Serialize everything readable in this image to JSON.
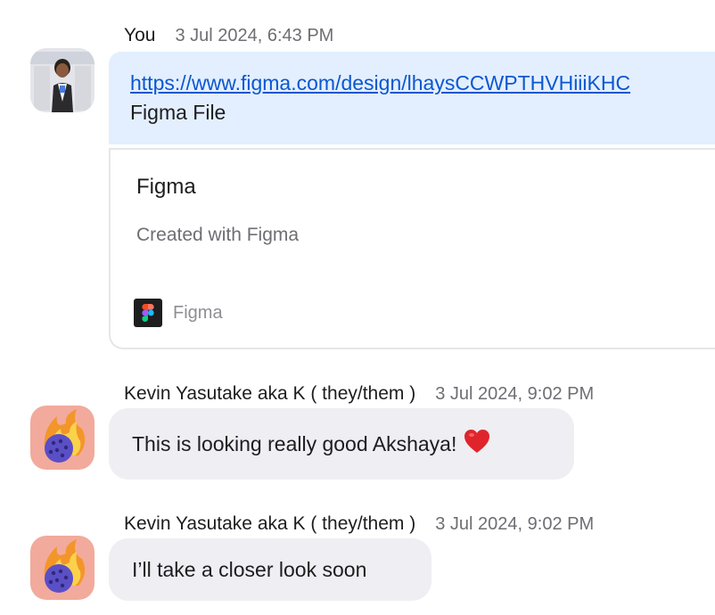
{
  "messages": [
    {
      "sender": "You",
      "time": "3 Jul 2024, 6:43 PM",
      "link": "https://www.figma.com/design/lhaysCCWPTHVHiiiKHC",
      "link_text": "Figma File",
      "preview": {
        "title": "Figma",
        "description": "Created with Figma",
        "source": "Figma"
      }
    },
    {
      "sender": "Kevin Yasutake aka K ( they/them )",
      "time": "3 Jul 2024, 9:02 PM",
      "text": "This is looking really good Akshaya!",
      "emoji": "heart"
    },
    {
      "sender": "Kevin Yasutake aka K ( they/them )",
      "time": "3 Jul 2024, 9:02 PM",
      "text": "I’ll take a closer look soon"
    }
  ],
  "colors": {
    "self_bubble": "#e3effe",
    "other_bubble": "#eeeef3",
    "link": "#0b57d0"
  }
}
